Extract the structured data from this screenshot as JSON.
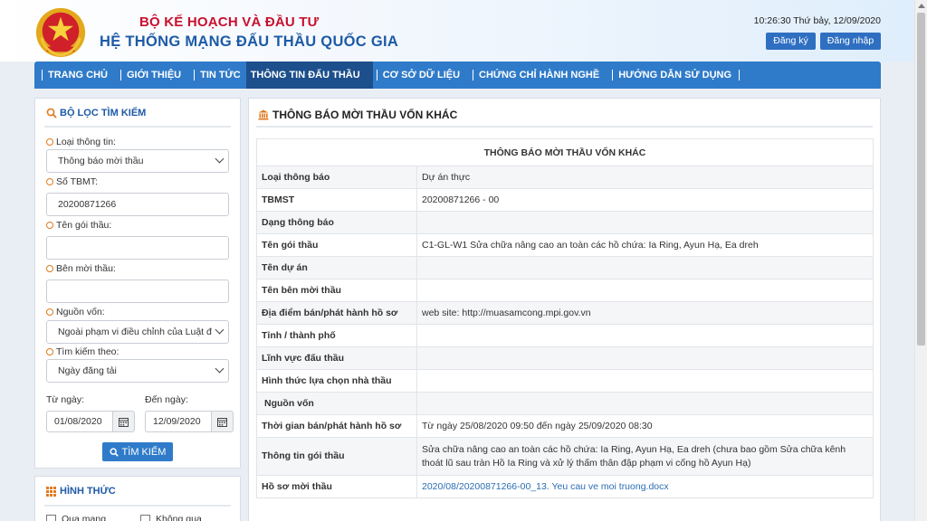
{
  "header": {
    "ministry": "BỘ KẾ HOẠCH VÀ ĐẦU TƯ",
    "system": "HỆ THỐNG MẠNG ĐẤU THẦU QUỐC GIA",
    "datetime": "10:26:30 Thứ bảy, 12/09/2020",
    "register_label": "Đăng ký",
    "login_label": "Đăng nhập"
  },
  "nav": {
    "items": [
      {
        "label": "TRANG CHỦ"
      },
      {
        "label": "GIỚI THIỆU"
      },
      {
        "label": "TIN TỨC"
      },
      {
        "label": "THÔNG TIN ĐẤU THẦU"
      },
      {
        "label": "CƠ SỞ DỮ LIỆU"
      },
      {
        "label": "CHỨNG CHỈ HÀNH NGHỀ"
      },
      {
        "label": "HƯỚNG DẪN SỬ DỤNG"
      }
    ]
  },
  "filter": {
    "title": "BỘ LỌC TÌM KIẾM",
    "info_type_label": "Loại thông tin:",
    "info_type_value": "Thông báo mời thầu",
    "tbmt_label": "Số TBMT:",
    "tbmt_value": "20200871266",
    "package_label": "Tên gói thầu:",
    "inviter_label": "Bên mời thầu:",
    "fund_label": "Nguồn vốn:",
    "fund_value": "Ngoài phạm vi điều chỉnh của Luật đ",
    "search_by_label": "Tìm kiếm theo:",
    "search_by_value": "Ngày đăng tải",
    "from_label": "Từ ngày:",
    "from_value": "01/08/2020",
    "to_label": "Đến ngày:",
    "to_value": "12/09/2020",
    "search_button": "TÌM KIẾM"
  },
  "form_box": {
    "title": "HÌNH THỨC",
    "opt1": "Qua mạng",
    "opt2": "Không qua"
  },
  "main": {
    "title": "THÔNG BÁO MỜI THẦU VỐN KHÁC",
    "table_header": "THÔNG BÁO MỜI THẦU VỐN KHÁC",
    "rows": [
      {
        "key": "Loại thông báo",
        "value": "Dự án thực"
      },
      {
        "key": "TBMST",
        "value": "20200871266 - 00"
      },
      {
        "key": "Dạng thông báo",
        "value": ""
      },
      {
        "key": "Tên gói thầu",
        "value": "C1-GL-W1 Sửa chữa nâng cao an toàn các hồ chứa: Ia Ring, Ayun Hạ, Ea dreh"
      },
      {
        "key": "Tên dự án",
        "value": ""
      },
      {
        "key": "Tên bên mời thầu",
        "value": ""
      },
      {
        "key": "Địa điểm bán/phát hành hồ sơ",
        "value": "web site: http://muasamcong.mpi.gov.vn"
      },
      {
        "key": "Tỉnh / thành phố",
        "value": ""
      },
      {
        "key": "Lĩnh vực đấu thầu",
        "value": ""
      },
      {
        "key": "Hình thức lựa chọn nhà thầu",
        "value": ""
      },
      {
        "key": "Nguồn vốn",
        "value": ""
      },
      {
        "key": "Thời gian bán/phát hành hồ sơ",
        "value": "Từ ngày 25/08/2020 09:50 đến ngày 25/09/2020 08:30"
      },
      {
        "key": "Thông tin gói thầu",
        "value": "Sửa chữa nâng cao an toàn các hồ chứa: Ia Ring, Ayun Hạ, Ea dreh (chưa bao gồm Sửa chữa kênh thoát lũ sau tràn Hồ Ia Ring và xử lý thấm thân đập phạm vi cống hồ Ayun Hạ)"
      },
      {
        "key": "Hồ sơ mời thầu",
        "value": "2020/08/20200871266-00_13. Yeu cau ve moi truong.docx"
      }
    ]
  },
  "colors": {
    "brand_red": "#c8102e",
    "brand_blue": "#1d5aa6",
    "nav_blue": "#2f7bc9",
    "nav_active": "#1c4f8c"
  }
}
